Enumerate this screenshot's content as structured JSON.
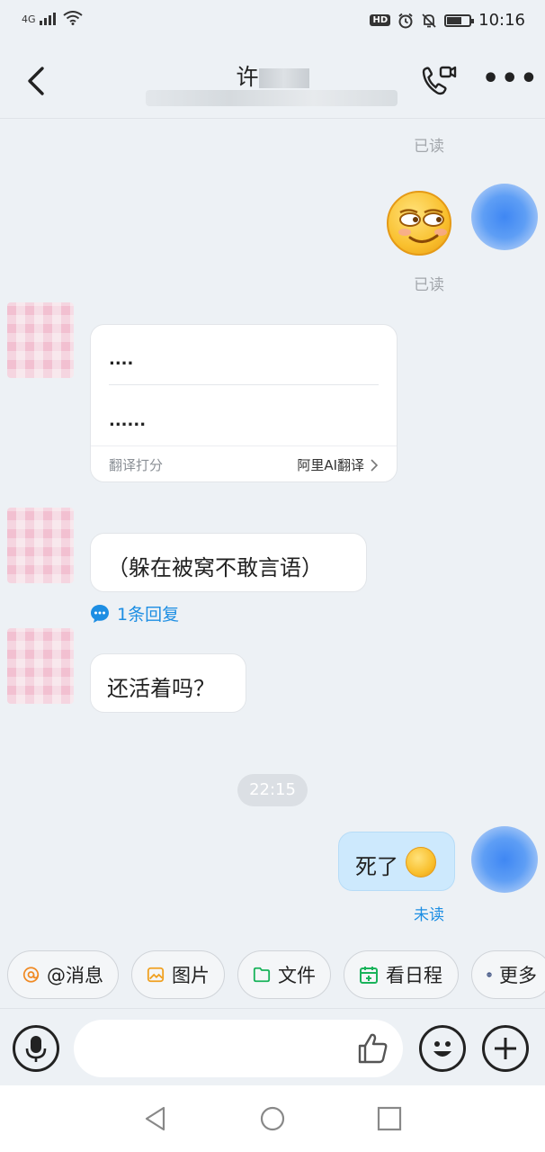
{
  "status_bar": {
    "network": "4G",
    "time": "10:16",
    "hd_badge": "HD"
  },
  "header": {
    "title": "许",
    "icons": {
      "back": "back-chevron-icon",
      "call": "video-call-icon",
      "more": "more-dots-icon"
    }
  },
  "messages": {
    "read_top": "已读",
    "read_emoji": "已读",
    "card": {
      "line1": "....",
      "line2": "......",
      "footer_left": "翻译打分",
      "footer_right": "阿里AI翻译"
    },
    "msg_hide": "（躲在被窝不敢言语）",
    "reply_count": "1条回复",
    "msg_alive": "还活着吗？",
    "time_divider": "22:15",
    "msg_dead": "死了",
    "unread": "未读"
  },
  "quick_actions": [
    {
      "label": "@消息",
      "icon": "at-icon",
      "color": "#f08a24"
    },
    {
      "label": "图片",
      "icon": "image-icon",
      "color": "#f0a020"
    },
    {
      "label": "文件",
      "icon": "folder-icon",
      "color": "#19b35b"
    },
    {
      "label": "看日程",
      "icon": "calendar-icon",
      "color": "#19b35b"
    },
    {
      "label": "更多",
      "icon": "more-icon",
      "color": "#4b5d8a"
    }
  ],
  "input": {
    "placeholder": ""
  },
  "colors": {
    "accent": "#1d8ee3",
    "bubble_self": "#cde9fd",
    "background": "#edf1f5"
  }
}
